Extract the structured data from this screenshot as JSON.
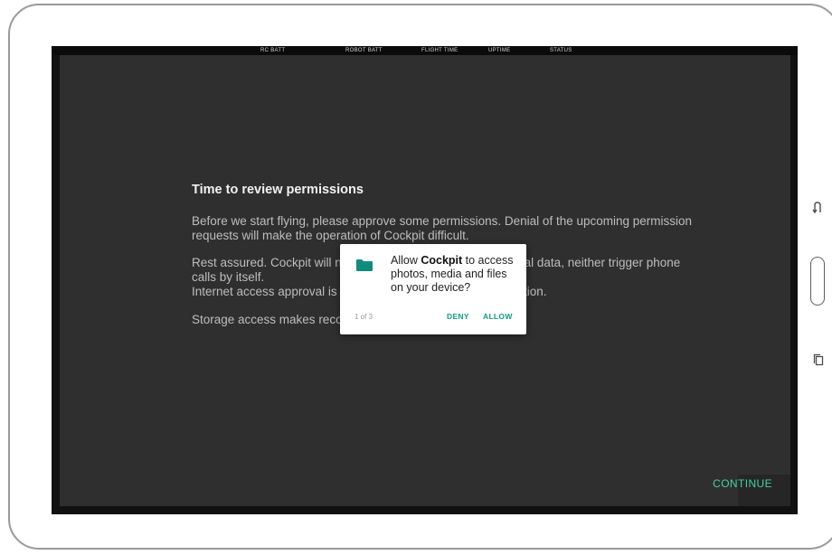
{
  "status_bar": {
    "labels": [
      "RC BATT",
      "ROBOT BATT",
      "FLIGHT TIME",
      "UPTIME",
      "STATUS"
    ]
  },
  "permissions_screen": {
    "title": "Time to review permissions",
    "paragraphs": [
      "Before we start flying, please approve some permissions. Denial of the upcoming permission requests will make the operation of Cockpit difficult.",
      "Rest assured. Cockpit will not access your contacts or personal data, neither trigger phone calls by itself.",
      "Internet access approval is needed for retrieving map information.",
      "Storage access makes recording videos of flights possible."
    ],
    "continue_label": "CONTINUE"
  },
  "permission_dialog": {
    "message_prefix": "Allow ",
    "app_name": "Cockpit",
    "message_suffix": " to access photos, media and files on your device?",
    "counter": "1 of 3",
    "deny_label": "DENY",
    "allow_label": "ALLOW",
    "icon": "folder-icon"
  },
  "device_nav": {
    "icons": [
      "back-icon",
      "home-key",
      "recent-apps-icon"
    ]
  },
  "colors": {
    "accent": "#42d2a3",
    "dialog_accent": "#119b85",
    "panel_bg": "#2f2f2f"
  }
}
